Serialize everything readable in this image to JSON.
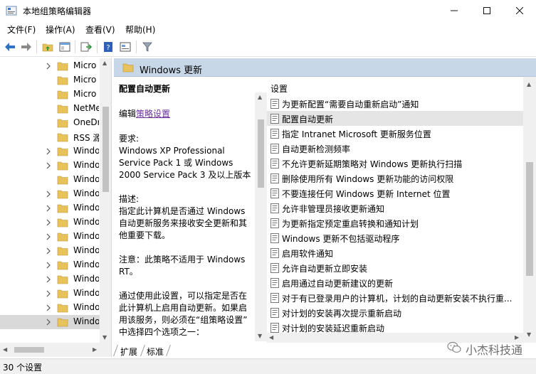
{
  "window": {
    "title": "本地组策略编辑器"
  },
  "menu": [
    "文件(F)",
    "操作(A)",
    "查看(V)",
    "帮助(H)"
  ],
  "tree": {
    "items": [
      {
        "label": "Micro",
        "chevron": true
      },
      {
        "label": "Micro",
        "chevron": false
      },
      {
        "label": "Micro",
        "chevron": false
      },
      {
        "label": "NetMe",
        "chevron": false
      },
      {
        "label": "OneDr",
        "chevron": false
      },
      {
        "label": "RSS 源",
        "chevron": false
      },
      {
        "label": "Windo",
        "chevron": true
      },
      {
        "label": "Windo",
        "chevron": true
      },
      {
        "label": "Windo",
        "chevron": false
      },
      {
        "label": "Windo",
        "chevron": true
      },
      {
        "label": "Windo",
        "chevron": true
      },
      {
        "label": "Windo",
        "chevron": true
      },
      {
        "label": "Windo",
        "chevron": true
      },
      {
        "label": "Windo",
        "chevron": true
      },
      {
        "label": "Windo",
        "chevron": true
      },
      {
        "label": "Windo",
        "chevron": true
      },
      {
        "label": "Windo",
        "chevron": true
      },
      {
        "label": "Windo",
        "chevron": true
      },
      {
        "label": "Windo",
        "chevron": true,
        "selected": true
      }
    ]
  },
  "header": {
    "title": "Windows 更新"
  },
  "description": {
    "title": "配置自动更新",
    "edit_prefix": "编辑",
    "edit_link": "策略设置",
    "requirements_label": "要求:",
    "requirements_lines": [
      "Windows XP Professional",
      "Service Pack 1 或 Windows",
      "2000 Service Pack 3 及以上版本"
    ],
    "description_label": "描述:",
    "description_lines": [
      "指定此计算机是否通过 Windows",
      "自动更新服务来接收安全更新和其",
      "他重要下载。"
    ],
    "note_lines": [
      "注意：此策略不适用于 Windows",
      "RT。"
    ],
    "usage_lines": [
      "通过使用此设置，可以指定是否在",
      "此计算机上启用自动更新。如果启",
      "用该服务，则必须在“组策略设置”",
      "中选择四个选项之一："
    ]
  },
  "settings": {
    "column_header": "设置",
    "items": [
      "为更新配置“需要自动重新启动”通知",
      "配置自动更新",
      "指定 Intranet Microsoft 更新服务位置",
      "自动更新检测频率",
      "不允许更新延期策略对 Windows 更新执行扫描",
      "删除使用所有 Windows 更新功能的访问权限",
      "不要连接任何 Windows 更新 Internet 位置",
      "允许非管理员接收更新通知",
      "为更新指定预定重启转换和通知计划",
      "Windows 更新不包括驱动程序",
      "启用软件通知",
      "允许自动更新立即安装",
      "启用通过自动更新建议的更新",
      "对于有已登录用户的计算机，计划的自动更新安装不执行重...",
      "对计划的安装再次提示重新启动",
      "对计划的安装延迟重新启动"
    ],
    "selected_index": 1
  },
  "tabs": [
    "扩展",
    "标准"
  ],
  "status": {
    "text": "30 个设置"
  },
  "watermark": {
    "text": "小杰科技通"
  },
  "colors": {
    "header_bg": "#c7d7e8",
    "link": "#6b2fa0",
    "folder": "#e8c25a"
  }
}
